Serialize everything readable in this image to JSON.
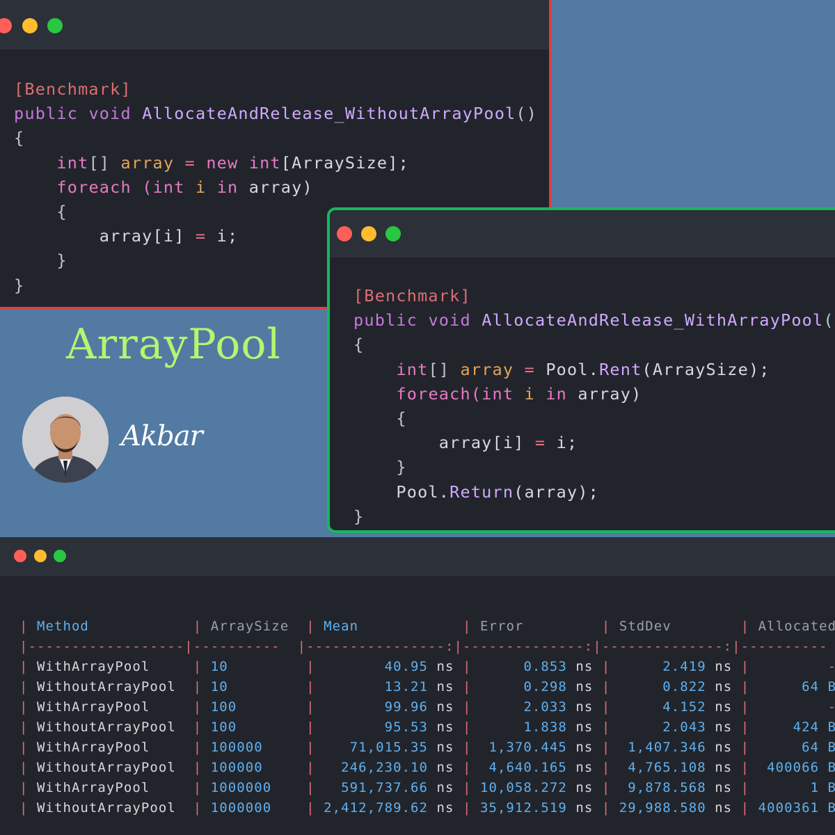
{
  "brand": {
    "title": "ArrayPool",
    "author": "Akbar"
  },
  "window1": {
    "lines": [
      [
        {
          "t": "[Benchmark]",
          "c": "attr"
        }
      ],
      [
        {
          "t": "public",
          "c": "kw"
        },
        {
          "t": " "
        },
        {
          "t": "void",
          "c": "kw"
        },
        {
          "t": " "
        },
        {
          "t": "AllocateAndRelease_WithoutArrayPool",
          "c": "fn"
        },
        {
          "t": "()",
          "c": "punc"
        }
      ],
      [
        {
          "t": "{",
          "c": "punc"
        }
      ],
      [
        {
          "t": "    "
        },
        {
          "t": "int",
          "c": "pink"
        },
        {
          "t": "[] ",
          "c": "punc"
        },
        {
          "t": "array",
          "c": "var"
        },
        {
          "t": " "
        },
        {
          "t": "=",
          "c": "op"
        },
        {
          "t": " "
        },
        {
          "t": "new",
          "c": "pink"
        },
        {
          "t": " "
        },
        {
          "t": "int",
          "c": "pink"
        },
        {
          "t": "[ArraySize];",
          "c": "ident"
        }
      ],
      [
        {
          "t": "    "
        },
        {
          "t": "foreach",
          "c": "pink"
        },
        {
          "t": " "
        },
        {
          "t": "(",
          "c": "pink"
        },
        {
          "t": "int",
          "c": "pink"
        },
        {
          "t": " "
        },
        {
          "t": "i",
          "c": "var"
        },
        {
          "t": " "
        },
        {
          "t": "in",
          "c": "pink"
        },
        {
          "t": " array)",
          "c": "ident"
        }
      ],
      [
        {
          "t": "    {",
          "c": "punc"
        }
      ],
      [
        {
          "t": "        array[i] ",
          "c": "ident"
        },
        {
          "t": "=",
          "c": "op"
        },
        {
          "t": " i;",
          "c": "ident"
        }
      ],
      [
        {
          "t": "    }",
          "c": "punc"
        }
      ],
      [
        {
          "t": "}",
          "c": "punc"
        }
      ]
    ]
  },
  "window2": {
    "lines": [
      [
        {
          "t": "[Benchmark]",
          "c": "attr"
        }
      ],
      [
        {
          "t": "public",
          "c": "kw"
        },
        {
          "t": " "
        },
        {
          "t": "void",
          "c": "kw"
        },
        {
          "t": " "
        },
        {
          "t": "AllocateAndRelease_WithArrayPool",
          "c": "fn"
        },
        {
          "t": "()",
          "c": "punc"
        }
      ],
      [
        {
          "t": "{",
          "c": "punc"
        }
      ],
      [
        {
          "t": "    "
        },
        {
          "t": "int",
          "c": "pink"
        },
        {
          "t": "[] ",
          "c": "punc"
        },
        {
          "t": "array",
          "c": "var"
        },
        {
          "t": " "
        },
        {
          "t": "=",
          "c": "op"
        },
        {
          "t": " Pool.",
          "c": "ident"
        },
        {
          "t": "Rent",
          "c": "fn"
        },
        {
          "t": "(ArraySize);",
          "c": "ident"
        }
      ],
      [
        {
          "t": "    "
        },
        {
          "t": "foreach",
          "c": "pink"
        },
        {
          "t": "(",
          "c": "pink"
        },
        {
          "t": "int",
          "c": "pink"
        },
        {
          "t": " "
        },
        {
          "t": "i",
          "c": "var"
        },
        {
          "t": " "
        },
        {
          "t": "in",
          "c": "pink"
        },
        {
          "t": " array)",
          "c": "ident"
        }
      ],
      [
        {
          "t": "    {",
          "c": "punc"
        }
      ],
      [
        {
          "t": "        array[i] ",
          "c": "ident"
        },
        {
          "t": "=",
          "c": "op"
        },
        {
          "t": " i;",
          "c": "ident"
        }
      ],
      [
        {
          "t": "    }",
          "c": "punc"
        }
      ],
      [
        {
          "t": "    Pool.",
          "c": "ident"
        },
        {
          "t": "Return",
          "c": "fn"
        },
        {
          "t": "(array);",
          "c": "ident"
        }
      ],
      [
        {
          "t": "}",
          "c": "punc"
        }
      ]
    ]
  },
  "table": {
    "headers": [
      "Method",
      "ArraySize",
      "Mean",
      "Error",
      "StdDev",
      "Allocated"
    ],
    "separator": "|------------------|----------  |----------------:|--------------:|--------------:|----------  |",
    "rows": [
      [
        "WithArrayPool",
        "10",
        "40.95",
        "0.853",
        "2.419",
        "-"
      ],
      [
        "WithoutArrayPool",
        "10",
        "13.21",
        "0.298",
        "0.822",
        "64 B"
      ],
      [
        "WithArrayPool",
        "100",
        "99.96",
        "2.033",
        "4.152",
        "-"
      ],
      [
        "WithoutArrayPool",
        "100",
        "95.53",
        "1.838",
        "2.043",
        "424 B"
      ],
      [
        "WithArrayPool",
        "100000",
        "71,015.35",
        "1,370.445",
        "1,407.346",
        "64 B"
      ],
      [
        "WithoutArrayPool",
        "100000",
        "246,230.10",
        "4,640.165",
        "4,765.108",
        "400066 B"
      ],
      [
        "WithArrayPool",
        "1000000",
        "591,737.66",
        "10,058.272",
        "9,878.568",
        "1 B"
      ],
      [
        "WithoutArrayPool",
        "1000000",
        "2,412,789.62",
        "35,912.519",
        "29,988.580",
        "4000361 B"
      ]
    ],
    "unit": "ns"
  }
}
